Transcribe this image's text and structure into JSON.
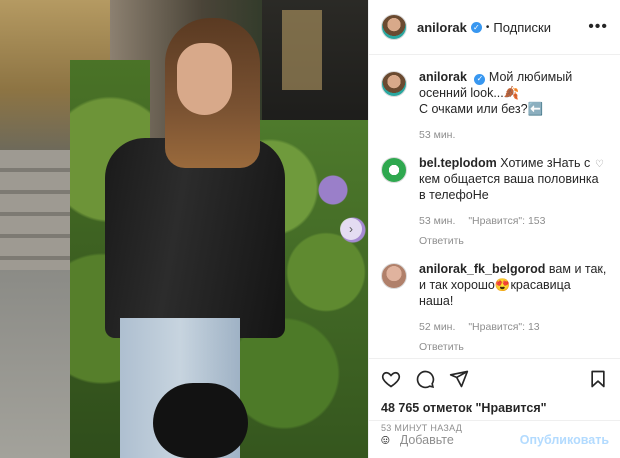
{
  "header": {
    "username": "anilorak",
    "separator": "•",
    "follow_label": "Подписки",
    "more_label": "•••"
  },
  "caption": {
    "username": "anilorak",
    "text": "Мой любимый осенний look...🍂\nС очками или без?⬅️",
    "time": "53 мин."
  },
  "comments": [
    {
      "username": "bel.teplodom",
      "text": "Хотиме зНать с кем общается ваша половинка в телефоНе",
      "time": "53 мин.",
      "likes": "\"Нравится\": 153",
      "reply": ""
    },
    {
      "username": "anilorak_fk_belgorod",
      "text": "вам и так, и так хорошо😍красавица наша!",
      "time": "52 мин.",
      "likes": "\"Нравится\": 13",
      "reply": "Ответить"
    }
  ],
  "first_comment_reply": "Ответить",
  "post": {
    "likes": "48 765 отметок \"Нравится\"",
    "time": "53 МИНУТ НАЗАД"
  },
  "add_comment": {
    "placeholder": "Добавьте",
    "publish_label": "Опубликовать"
  },
  "colors": {
    "verified": "#3897f0",
    "publish_disabled": "#b3dbff",
    "meta_gray": "#8e8e8e"
  }
}
